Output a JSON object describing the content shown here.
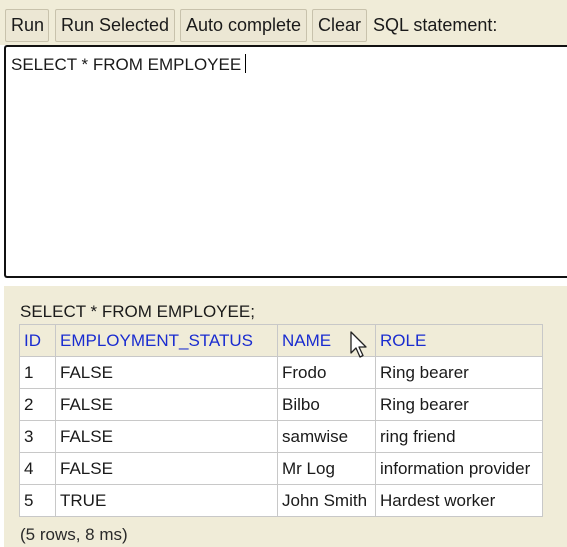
{
  "toolbar": {
    "run_label": "Run",
    "run_selected_label": "Run Selected",
    "auto_complete_label": "Auto complete",
    "clear_label": "Clear",
    "sql_statement_label": "SQL statement:"
  },
  "editor": {
    "value": "SELECT * FROM EMPLOYEE"
  },
  "results": {
    "query": "SELECT * FROM EMPLOYEE;",
    "columns": [
      "ID",
      "EMPLOYMENT_STATUS",
      "NAME",
      "ROLE"
    ],
    "rows": [
      [
        "1",
        "FALSE",
        "Frodo",
        "Ring bearer"
      ],
      [
        "2",
        "FALSE",
        "Bilbo",
        "Ring bearer"
      ],
      [
        "3",
        "FALSE",
        "samwise",
        "ring friend"
      ],
      [
        "4",
        "FALSE",
        "Mr Log",
        "information provider"
      ],
      [
        "5",
        "TRUE",
        "John Smith",
        "Hardest worker"
      ]
    ],
    "summary": "(5 rows, 8 ms)"
  },
  "colors": {
    "panel_background": "#f0ecd8",
    "header_text": "#1a2cd0"
  },
  "icons": {
    "mouse_cursor": "mouse-pointer-icon"
  }
}
